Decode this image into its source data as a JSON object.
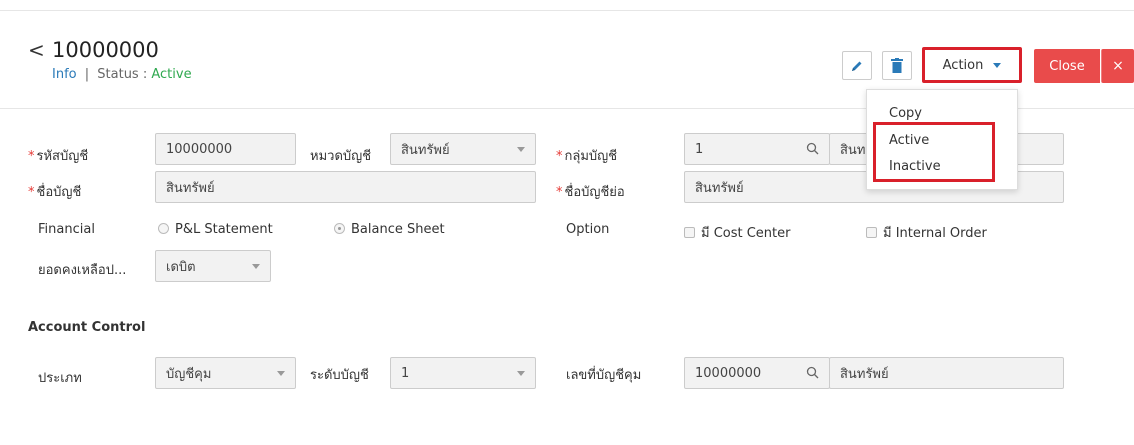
{
  "header": {
    "back_glyph": "<",
    "title": "10000000",
    "info_link": "Info",
    "separator": "|",
    "status_label": "Status :",
    "status_value": "Active"
  },
  "toolbar": {
    "action_label": "Action",
    "close_label": "Close",
    "close_x": "×"
  },
  "action_menu": {
    "items": [
      "Copy",
      "Active",
      "Inactive"
    ]
  },
  "form": {
    "account_code_label": "รหัสบัญชี",
    "account_code_value": "10000000",
    "account_category_label": "หมวดบัญชี",
    "account_category_value": "สินทรัพย์",
    "account_group_label": "กลุ่มบัญชี",
    "account_group_value": "1",
    "account_group_name": "สินท",
    "account_name_label": "ชื่อบัญชี",
    "account_name_value": "สินทรัพย์",
    "account_short_label": "ชื่อบัญชีย่อ",
    "account_short_value": "สินทรัพย์",
    "financial_label": "Financial",
    "financial_options": [
      "P&L Statement",
      "Balance Sheet"
    ],
    "financial_selected": "Balance Sheet",
    "option_label": "Option",
    "option_checks": [
      "มี Cost Center",
      "มี Internal Order"
    ],
    "balance_label": "ยอดคงเหลือป...",
    "balance_value": "เดบิต"
  },
  "account_control": {
    "section_title": "Account Control",
    "type_label": "ประเภท",
    "type_value": "บัญชีคุม",
    "level_label": "ระดับบัญชี",
    "level_value": "1",
    "control_no_label": "เลขที่บัญชีคุม",
    "control_no_value": "10000000",
    "control_name_value": "สินทรัพย์"
  },
  "colors": {
    "accent_blue": "#2a7ab8",
    "status_green": "#2fa84f",
    "close_red": "#e94b4b",
    "highlight_red": "#d9202a",
    "required_red": "#e53935"
  }
}
